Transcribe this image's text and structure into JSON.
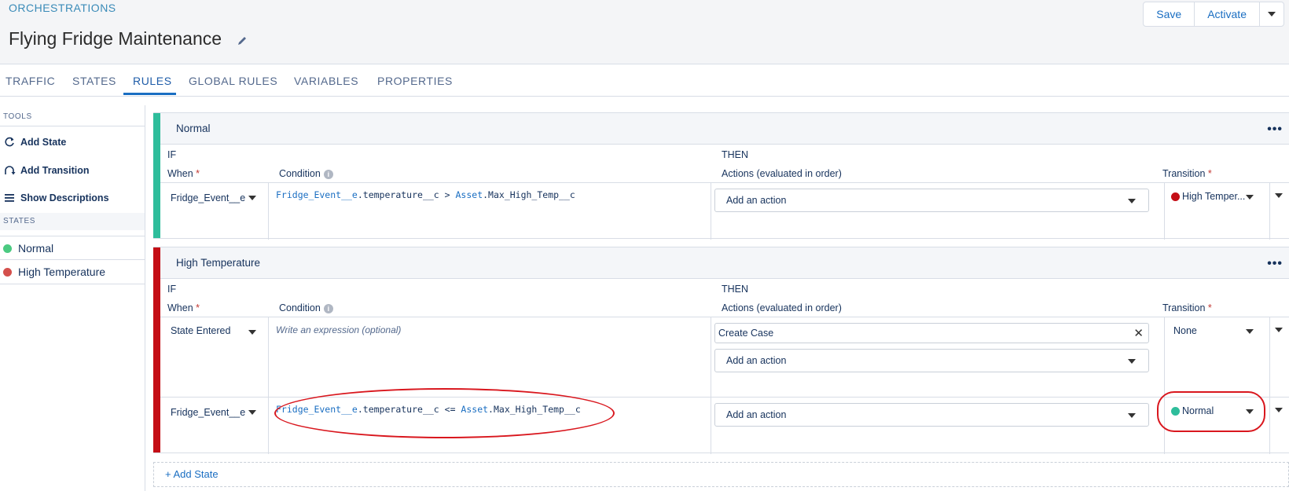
{
  "header": {
    "breadcrumb": "ORCHESTRATIONS",
    "title": "Flying Fridge Maintenance",
    "save_label": "Save",
    "activate_label": "Activate"
  },
  "tabs": [
    "TRAFFIC",
    "STATES",
    "RULES",
    "GLOBAL RULES",
    "VARIABLES",
    "PROPERTIES"
  ],
  "active_tab": "RULES",
  "sidebar": {
    "tools_heading": "TOOLS",
    "tools": [
      "Add State",
      "Add Transition",
      "Show Descriptions"
    ],
    "states_heading": "STATES",
    "states": [
      {
        "label": "Normal",
        "color": "#4bca81"
      },
      {
        "label": "High Temperature",
        "color": "#d4504c"
      }
    ]
  },
  "labels": {
    "if": "IF",
    "then": "THEN",
    "when": "When",
    "condition": "Condition",
    "actions": "Actions (evaluated in order)",
    "transition": "Transition",
    "required": "*",
    "add_action": "Add an action"
  },
  "cards": [
    {
      "name": "Normal",
      "color": "#2ebd9b",
      "rules": [
        {
          "when": "Fridge_Event__e",
          "condition": {
            "obj1": "Fridge_Event__e",
            "field1": ".temperature__c",
            "op": " > ",
            "obj2": "Asset",
            "field2": ".Max_High_Temp__c"
          },
          "transition": "High Temper...",
          "transition_color": "#c40e16"
        }
      ]
    },
    {
      "name": "High Temperature",
      "color": "#c40e16",
      "rules": [
        {
          "when": "State Entered",
          "condition_placeholder": "Write an expression (optional)",
          "action_chip": "Create Case",
          "transition": "None"
        },
        {
          "when": "Fridge_Event__e",
          "condition": {
            "obj1": "Fridge_Event__e",
            "field1": ".temperature__c",
            "op": " <= ",
            "obj2": "Asset",
            "field2": ".Max_High_Temp__c"
          },
          "transition": "Normal",
          "transition_color": "#2ebd9b"
        }
      ]
    }
  ],
  "add_state_label": "+ Add State",
  "colors": {
    "accent": "#1a6ec2",
    "annotation": "#d9171e"
  }
}
